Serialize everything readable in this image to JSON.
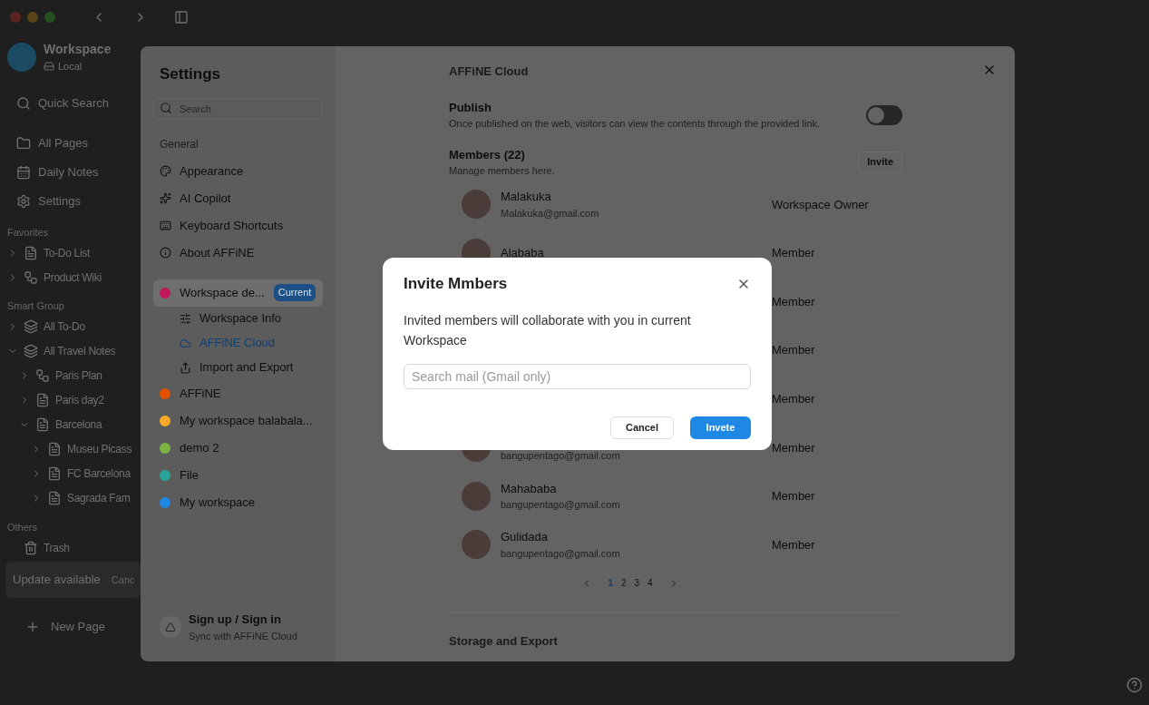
{
  "app_sidebar": {
    "workspace": {
      "name": "Workspace",
      "storage": "Local"
    },
    "quick_search": "Quick Search",
    "nav": [
      {
        "label": "All Pages",
        "kind": "folder"
      },
      {
        "label": "Daily Notes",
        "kind": "calendar"
      },
      {
        "label": "Settings",
        "kind": "gear"
      }
    ],
    "sections": [
      {
        "title": "Favorites",
        "items": [
          {
            "label": "To-Do List",
            "kind": "doc",
            "expanded": false
          },
          {
            "label": "Product Wiki",
            "kind": "edgeless",
            "expanded": false
          }
        ]
      },
      {
        "title": "Smart Group",
        "items": [
          {
            "label": "All To-Do",
            "kind": "group",
            "expanded": false
          },
          {
            "label": "All Travel Notes",
            "kind": "group",
            "expanded": true,
            "children": [
              {
                "label": "Paris Plan",
                "kind": "edgeless",
                "expanded": false
              },
              {
                "label": "Paris day2",
                "kind": "doc",
                "expanded": false
              },
              {
                "label": "Barcelona",
                "kind": "doc",
                "expanded": true,
                "children": [
                  {
                    "label": "Museu Picass",
                    "kind": "doc",
                    "expanded": false
                  },
                  {
                    "label": "FC Barcelona",
                    "kind": "doc",
                    "expanded": false
                  },
                  {
                    "label": "Sagrada Fam",
                    "kind": "doc",
                    "expanded": false
                  }
                ]
              }
            ]
          }
        ]
      },
      {
        "title": "Others",
        "items": [
          {
            "label": "Trash",
            "kind": "trash"
          }
        ]
      }
    ],
    "update": {
      "label": "Update available",
      "action": "Canc"
    },
    "new_page": "New Page"
  },
  "settings": {
    "title": "Settings",
    "search_placeholder": "Search",
    "general_label": "General",
    "general": [
      {
        "label": "Appearance",
        "kind": "palette"
      },
      {
        "label": "AI Copilot",
        "kind": "ai"
      },
      {
        "label": "Keyboard Shortcuts",
        "kind": "keyboard"
      },
      {
        "label": "About AFFiNE",
        "kind": "info"
      }
    ],
    "workspaces": [
      {
        "name": "Workspace de...",
        "badge": "Current",
        "color": "#c2185b",
        "selected": true,
        "children": [
          {
            "label": "Workspace Info",
            "kind": "sliders",
            "selected": false
          },
          {
            "label": "AFFiNE Cloud",
            "kind": "cloud",
            "selected": true
          },
          {
            "label": "Import and Export",
            "kind": "export",
            "selected": false
          }
        ]
      },
      {
        "name": "AFFiNE",
        "color": "#e65100",
        "selected": false
      },
      {
        "name": "My workspace balabala...",
        "color": "#f9a825",
        "selected": false
      },
      {
        "name": "demo 2",
        "color": "#7cb342",
        "selected": false
      },
      {
        "name": "File",
        "color": "#26a69a",
        "selected": false
      },
      {
        "name": "My workspace",
        "color": "#1e88e5",
        "selected": false
      }
    ],
    "account": {
      "title": "Sign up / Sign in",
      "subtitle": "Sync with AFFiNE Cloud"
    }
  },
  "content": {
    "section_title": "AFFiNE Cloud",
    "publish": {
      "title": "Publish",
      "description": "Once published on the web, visitors can view the contents through the provided link.",
      "on": false
    },
    "members": {
      "title": "Members (22)",
      "description": "Manage members here.",
      "invite_button": "Invite",
      "rows": [
        {
          "name": "Malakuka",
          "email": "Malakuka@gmail.com",
          "role": "Workspace Owner",
          "avatar": true
        },
        {
          "name": "Alababa",
          "role": "Member",
          "avatar": true
        },
        {
          "role": "Member",
          "avatar": false
        },
        {
          "role": "Member",
          "avatar": false
        },
        {
          "role": "Member",
          "avatar": false
        },
        {
          "email": "bangupentago@gmail.com",
          "role": "Member",
          "avatar": true
        },
        {
          "name": "Mahababa",
          "email": "bangupentago@gmail.com",
          "role": "Member",
          "avatar": true
        },
        {
          "name": "Gulidada",
          "email": "bangupentago@gmail.com",
          "role": "Member",
          "avatar": true
        }
      ]
    },
    "pagination": [
      {
        "label": "1",
        "selected": true
      },
      {
        "label": "2",
        "selected": false
      },
      {
        "label": "3",
        "selected": false
      },
      {
        "label": "4",
        "selected": false
      }
    ],
    "storage_title": "Storage and Export"
  },
  "dialog": {
    "title": "Invite Mmbers",
    "description": "Invited members will collaborate with you in current Workspace",
    "input_placeholder": "Search mail (Gmail only)",
    "cancel": "Cancel",
    "confirm": "Invete"
  }
}
